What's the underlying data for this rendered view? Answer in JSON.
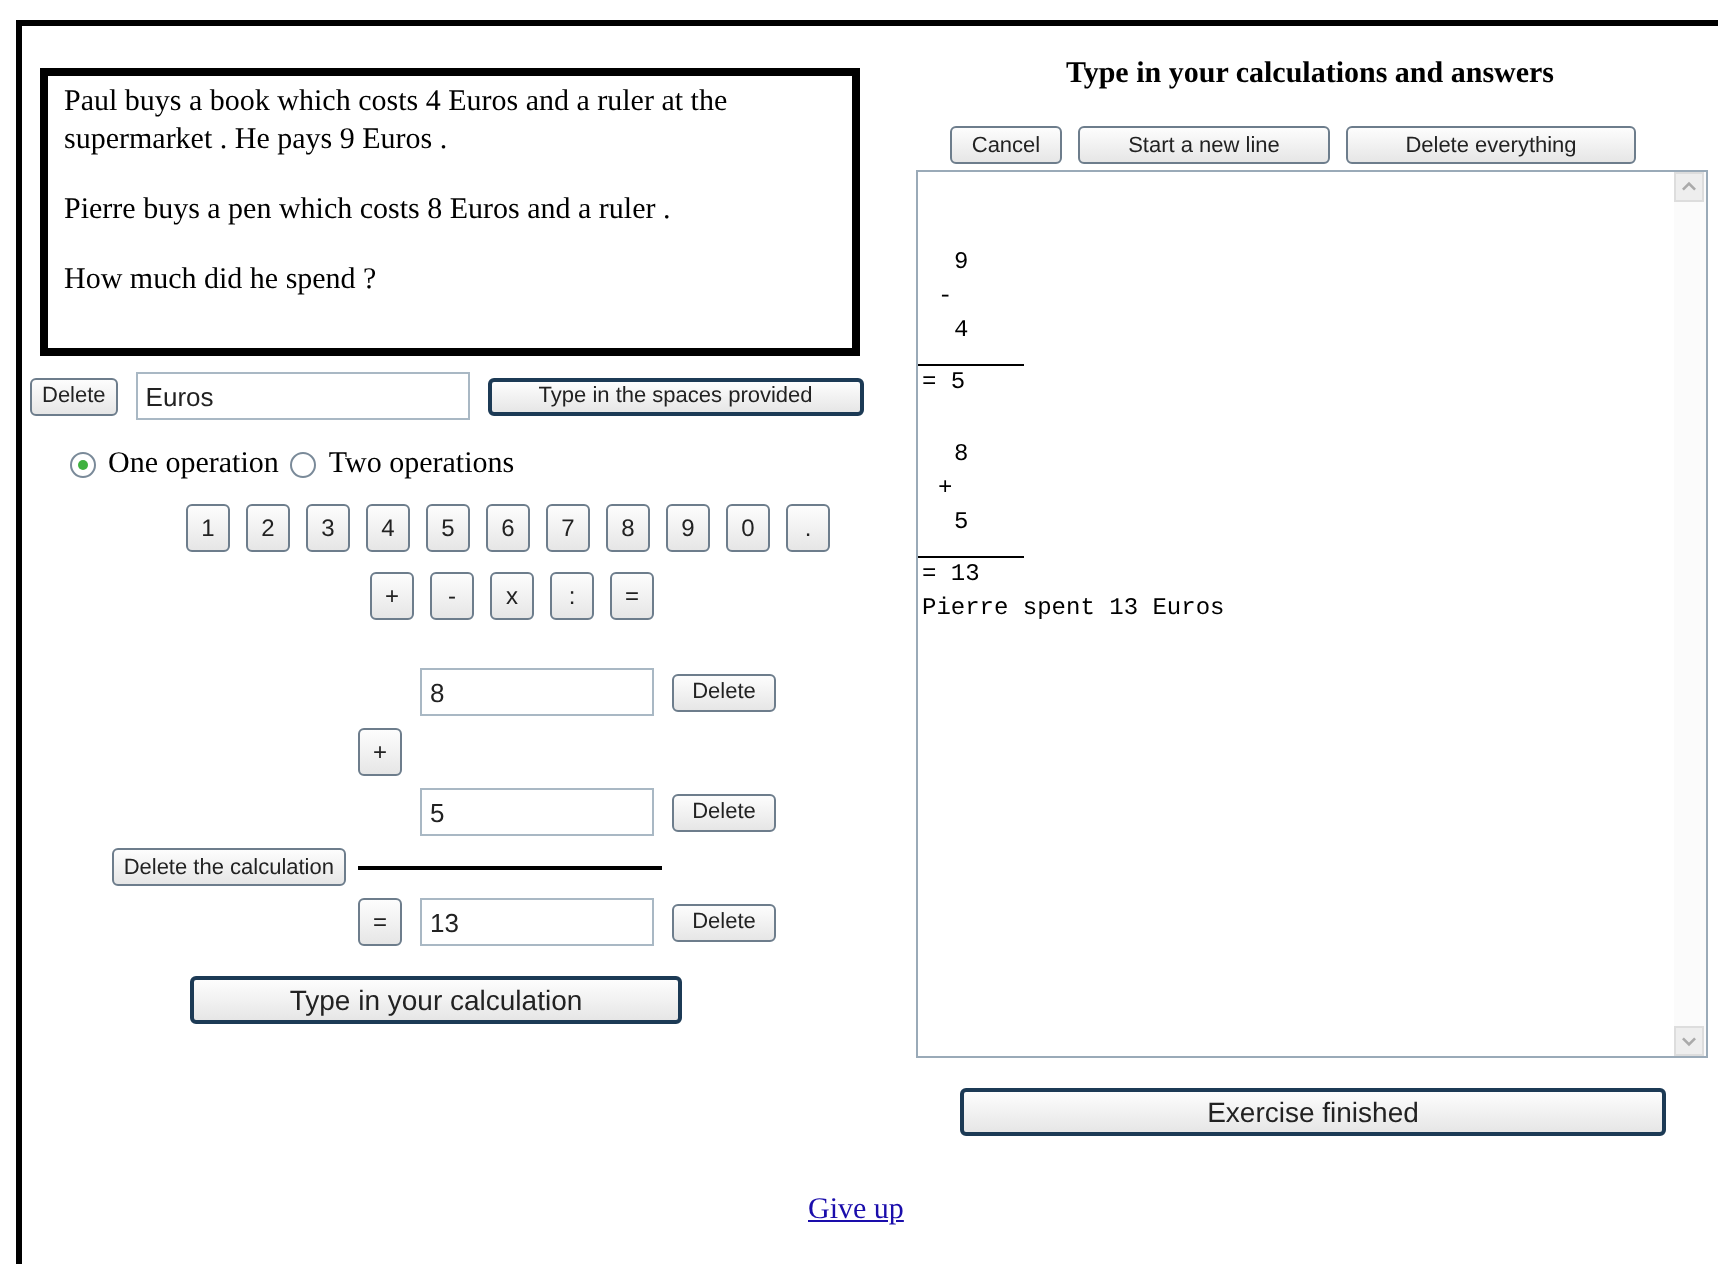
{
  "problem": {
    "paragraphs": [
      "Paul buys a book which costs 4 Euros and a ruler at the supermarket . He pays 9 Euros .",
      "Pierre buys a pen which costs 8 Euros and a ruler .",
      "How much did he spend ?"
    ]
  },
  "unit_row": {
    "delete_label": "Delete",
    "value": "Euros",
    "type_button": "Type in the spaces provided"
  },
  "operation_modes": [
    {
      "label": "One operation",
      "selected": true
    },
    {
      "label": "Two operations",
      "selected": false
    }
  ],
  "digit_keys": [
    "1",
    "2",
    "3",
    "4",
    "5",
    "6",
    "7",
    "8",
    "9",
    "0",
    "."
  ],
  "operator_keys": [
    "+",
    "-",
    "x",
    ":",
    "="
  ],
  "calculation": {
    "operand_1": "8",
    "operator": "+",
    "operand_2": "5",
    "equals": "=",
    "result": "13",
    "delete_labels": [
      "Delete",
      "Delete",
      "Delete"
    ],
    "delete_calculation": "Delete the calculation",
    "submit": "Type in your calculation"
  },
  "worksheet": {
    "title": "Type in your calculations and answers",
    "buttons": [
      "Cancel",
      "Start a new line",
      "Delete everything"
    ],
    "lines": [
      {
        "kind": "blank"
      },
      {
        "kind": "operand",
        "text": "9"
      },
      {
        "kind": "operator",
        "text": "-"
      },
      {
        "kind": "operand",
        "text": "4"
      },
      {
        "kind": "result",
        "text": "= 5"
      },
      {
        "kind": "blank"
      },
      {
        "kind": "operand",
        "text": "8"
      },
      {
        "kind": "operator",
        "text": "+"
      },
      {
        "kind": "operand",
        "text": "5"
      },
      {
        "kind": "result",
        "text": "= 13"
      },
      {
        "kind": "text",
        "text": "Pierre spent 13 Euros"
      }
    ],
    "finish": "Exercise finished"
  },
  "give_up": "Give up"
}
